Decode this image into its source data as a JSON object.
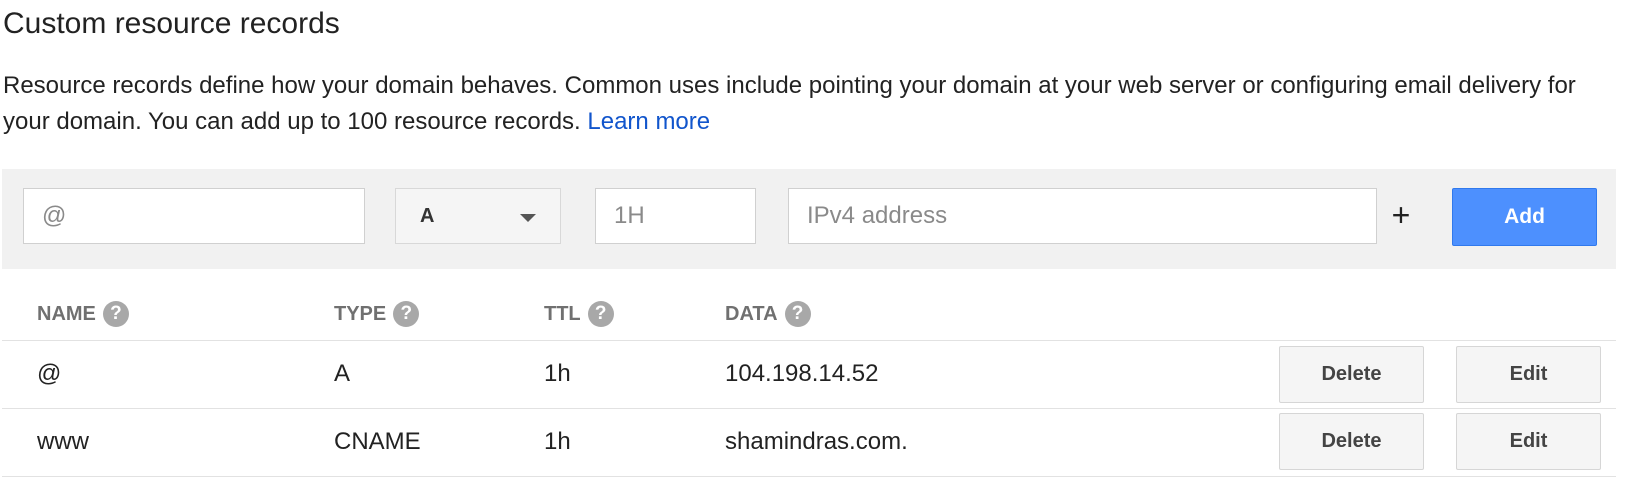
{
  "section": {
    "title": "Custom resource records",
    "description": "Resource records define how your domain behaves. Common uses include pointing your domain at your web server or configuring email delivery for your domain. You can add up to 100 resource records.",
    "learn_more": "Learn more"
  },
  "form": {
    "name_placeholder": "@",
    "type_value": "A",
    "ttl_placeholder": "1H",
    "data_placeholder": "IPv4 address",
    "plus_symbol": "+",
    "add_label": "Add"
  },
  "table": {
    "headers": {
      "name": "NAME",
      "type": "TYPE",
      "ttl": "TTL",
      "data": "DATA"
    },
    "help_symbol": "?",
    "rows": [
      {
        "name": "@",
        "type": "A",
        "ttl": "1h",
        "data": "104.198.14.52",
        "delete_label": "Delete",
        "edit_label": "Edit"
      },
      {
        "name": "www",
        "type": "CNAME",
        "ttl": "1h",
        "data": "shamindras.com.",
        "delete_label": "Delete",
        "edit_label": "Edit"
      }
    ]
  },
  "colors": {
    "accent": "#4d90fe",
    "link": "#1155cc",
    "form_background": "#f1f1f1",
    "help_icon": "#a8a8a8"
  }
}
